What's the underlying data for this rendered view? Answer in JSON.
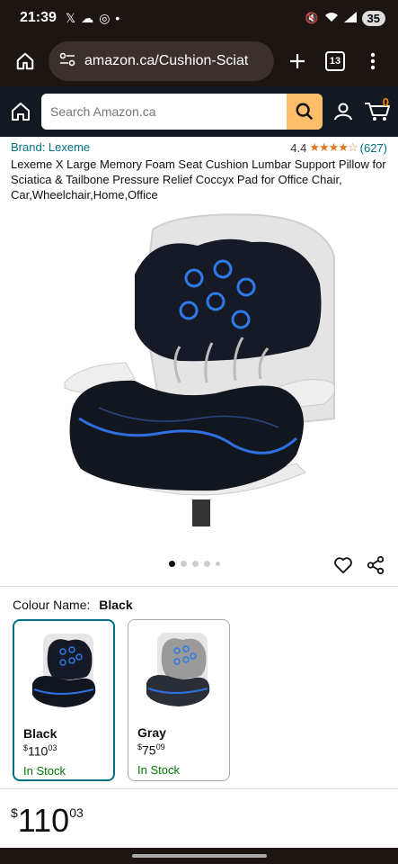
{
  "status": {
    "time": "21:39",
    "battery": "35"
  },
  "browser": {
    "url": "amazon.ca/Cushion-Sciat",
    "tab_count": "13"
  },
  "amazon": {
    "search_placeholder": "Search Amazon.ca",
    "cart_count": "0"
  },
  "product": {
    "brand": "Brand: Lexeme",
    "rating": "4.4",
    "stars": "★★★★☆",
    "review_count": "(627)",
    "title": "Lexeme X Large Memory Foam Seat Cushion Lumbar Support Pillow for Sciatica & Tailbone Pressure Relief Coccyx Pad for Office Chair, Car,Wheelchair,Home,Office"
  },
  "colour": {
    "label": "Colour Name:",
    "selected": "Black",
    "options": [
      {
        "name": "Black",
        "currency": "$",
        "whole": "110",
        "cents": "03",
        "stock": "In Stock"
      },
      {
        "name": "Gray",
        "currency": "$",
        "whole": "75",
        "cents": "09",
        "stock": "In Stock"
      }
    ]
  },
  "price": {
    "currency": "$",
    "whole": "110",
    "cents": "03"
  },
  "colors": {
    "amazon_dark": "#131921",
    "search_button": "#febd69",
    "link": "#007185",
    "in_stock": "#007600",
    "star": "#de7921"
  }
}
